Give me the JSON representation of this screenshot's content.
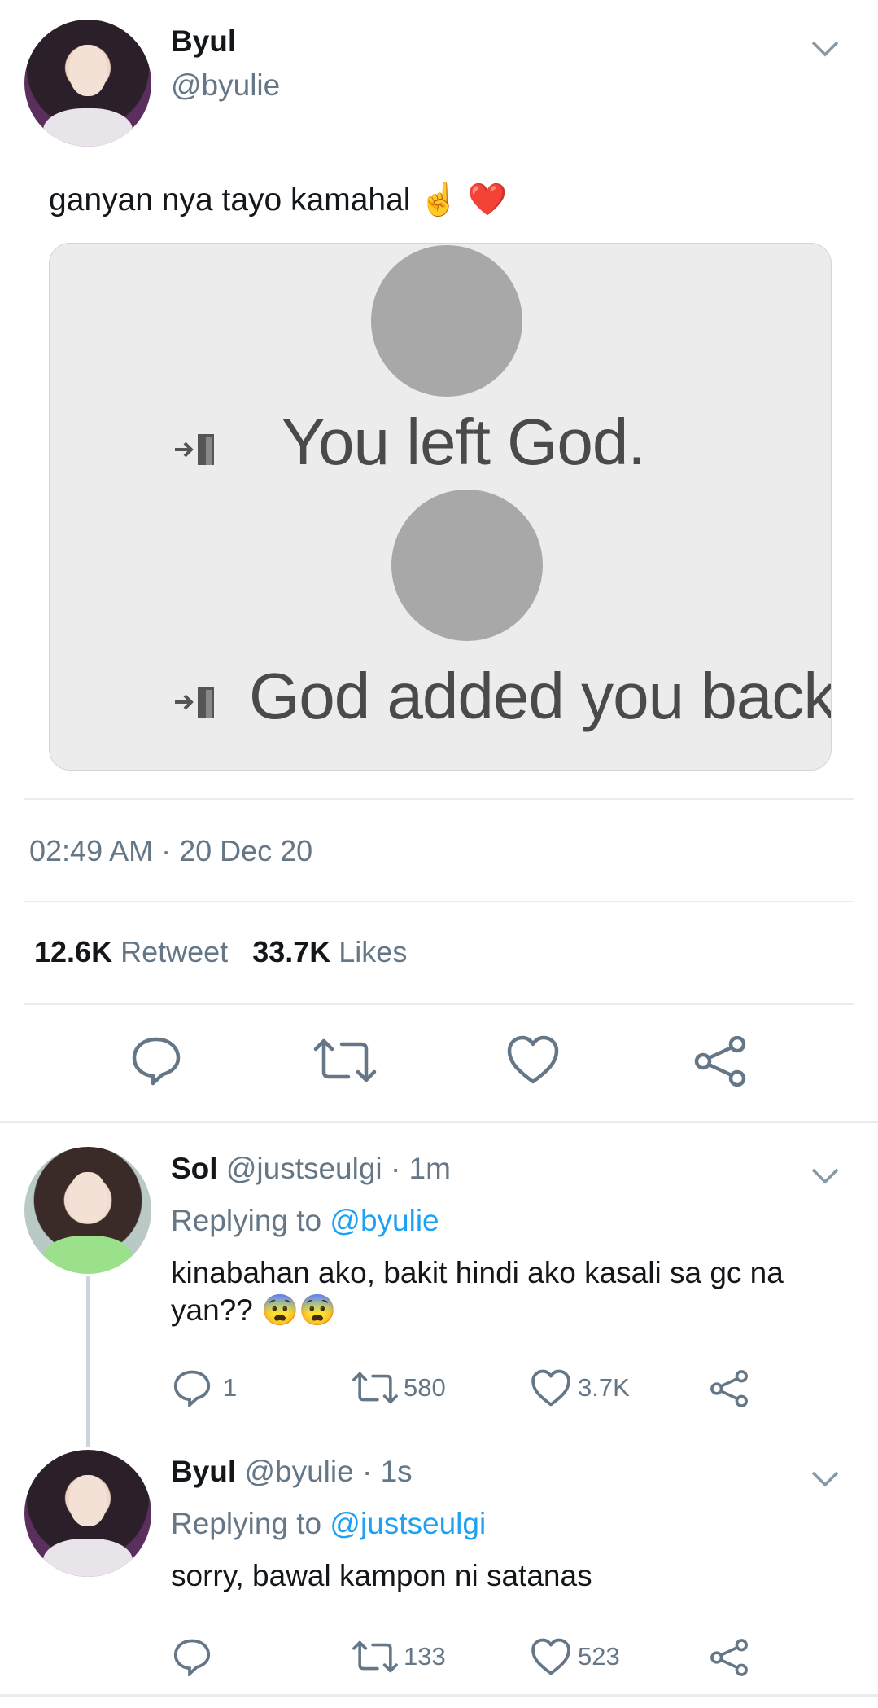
{
  "tweet": {
    "name": "Byul",
    "handle": "@byulie",
    "text": "ganyan nya tayo kamahal ☝️ ❤️",
    "media": {
      "line1": "You left God.",
      "line2": "God added you back."
    },
    "timestamp": "02:49 AM · 20 Dec 20",
    "retweets": "12.6K",
    "retweet_label": "Retweet",
    "likes": "33.7K",
    "likes_label": "Likes"
  },
  "replies": [
    {
      "name": "Sol",
      "handle": "@justseulgi",
      "time": "· 1m",
      "replying_prefix": "Replying to",
      "replying_to": "@byulie",
      "text_line1": "kinabahan ako, bakit hindi ako kasali sa gc na",
      "text_line2": "yan?? 😨😨",
      "replies": "1",
      "retweets": "580",
      "likes": "3.7K"
    },
    {
      "name": "Byul",
      "handle": "@byulie",
      "time": "· 1s",
      "replying_prefix": "Replying to",
      "replying_to": "@justseulgi",
      "text_line1": "sorry, bawal kampon ni satanas",
      "replies": "",
      "retweets": "133",
      "likes": "523"
    }
  ],
  "colors": {
    "link": "#1da1f2",
    "secondary": "#657786",
    "heart": "#e0245e"
  },
  "icons": [
    "chevron-down-icon",
    "reply-icon",
    "retweet-icon",
    "like-icon",
    "share-icon"
  ]
}
